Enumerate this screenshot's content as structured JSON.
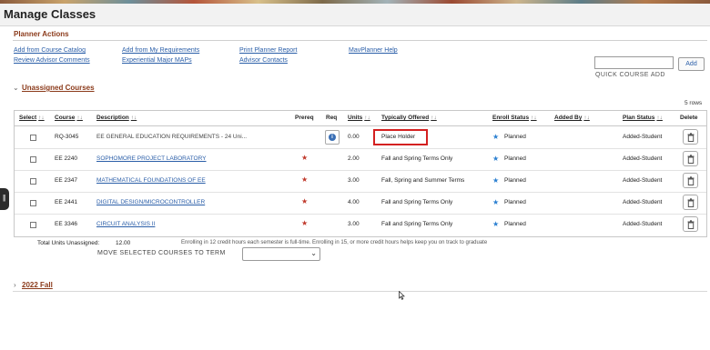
{
  "page": {
    "title": "Manage Classes"
  },
  "planner_actions": {
    "heading": "Planner Actions",
    "links": {
      "add_from_catalog": "Add from Course Catalog",
      "review_advisor_comments": "Review Advisor Comments",
      "add_from_requirements": "Add from My Requirements",
      "experiential_maps": "Experiential Major MAPs",
      "print_report": "Print Planner Report",
      "advisor_contacts": "Advisor Contacts",
      "mavplanner_help": "MavPlanner Help"
    }
  },
  "quick_add": {
    "value": "",
    "button_label": "Add",
    "label": "QUICK COURSE ADD"
  },
  "unassigned": {
    "title": "Unassigned Courses",
    "row_count": "5 rows",
    "columns": {
      "select": "Select",
      "course": "Course",
      "description": "Description",
      "prereq": "Prereq",
      "req": "Req",
      "units": "Units",
      "typically_offered": "Typically Offered",
      "enroll_status": "Enroll Status",
      "added_by": "Added By",
      "plan_status": "Plan Status",
      "delete": "Delete"
    },
    "sort_glyph": "↑↓",
    "rows": [
      {
        "course": "RQ-3045",
        "description": "EE GENERAL EDUCATION REQUIREMENTS - 24 Uni...",
        "description_is_link": false,
        "prereq": "",
        "units": "0.00",
        "offered": "Place Holder",
        "enroll_status": "Planned",
        "added_by": "",
        "plan_status": "Added-Student"
      },
      {
        "course": "EE 2240",
        "description": "SOPHOMORE PROJECT LABORATORY",
        "description_is_link": true,
        "prereq": "★",
        "units": "2.00",
        "offered": "Fall and Spring Terms Only",
        "enroll_status": "Planned",
        "added_by": "",
        "plan_status": "Added-Student"
      },
      {
        "course": "EE 2347",
        "description": "MATHEMATICAL FOUNDATIONS OF EE",
        "description_is_link": true,
        "prereq": "★",
        "units": "3.00",
        "offered": "Fall, Spring and Summer Terms",
        "enroll_status": "Planned",
        "added_by": "",
        "plan_status": "Added-Student"
      },
      {
        "course": "EE 2441",
        "description": "DIGITAL DESIGN/MICROCONTROLLER",
        "description_is_link": true,
        "prereq": "★",
        "units": "4.00",
        "offered": "Fall and Spring Terms Only",
        "enroll_status": "Planned",
        "added_by": "",
        "plan_status": "Added-Student"
      },
      {
        "course": "EE 3346",
        "description": "CIRCUIT ANALYSIS II",
        "description_is_link": true,
        "prereq": "★",
        "units": "3.00",
        "offered": "Fall and Spring Terms Only",
        "enroll_status": "Planned",
        "added_by": "",
        "plan_status": "Added-Student"
      }
    ],
    "total_label": "Total Units Unassigned:",
    "total_value": "12.00",
    "note": "Enrolling in 12 credit hours each semester is full-time. Enrolling in 15, or more credit hours helps keep you on track to graduate",
    "move_label": "MOVE SELECTED COURSES TO TERM",
    "move_value": ""
  },
  "next_term": {
    "title": "2022 Fall"
  },
  "icons": {
    "collapse": "chevron-down-icon",
    "expand": "chevron-right-icon",
    "info": "info-icon",
    "prereq": "star-icon",
    "status": "star-icon",
    "delete": "trash-icon"
  },
  "colors": {
    "section": "#8b3a1a",
    "link": "#2a5ea8",
    "prereq_star": "#c0392b",
    "status_star": "#2a7fd1",
    "highlight": "#d42020"
  }
}
